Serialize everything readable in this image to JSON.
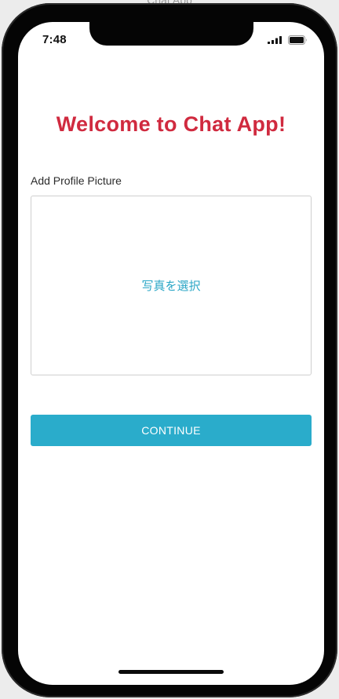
{
  "window": {
    "title": "Chat App"
  },
  "status_bar": {
    "time": "7:48",
    "icons": [
      "signal-icon",
      "battery-icon"
    ]
  },
  "main": {
    "title": "Welcome to Chat App!",
    "profile_label": "Add Profile Picture",
    "select_photo_link": "写真を選択",
    "continue_button": "CONTINUE"
  },
  "colors": {
    "title": "#d02a3f",
    "accent": "#2aaccb",
    "link": "#2aa6c6"
  }
}
